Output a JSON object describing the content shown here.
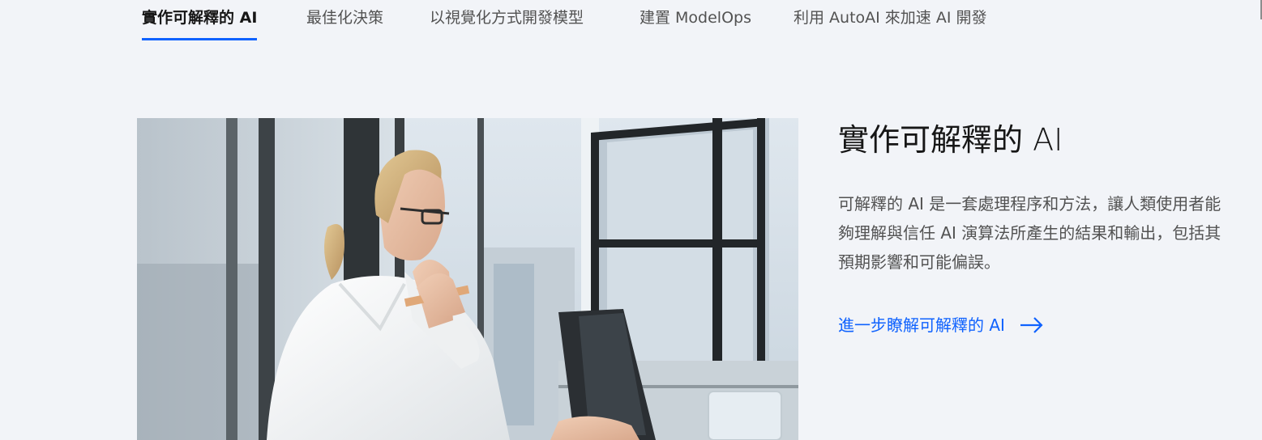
{
  "tabs": [
    {
      "label": "實作可解釋的 AI",
      "active": true
    },
    {
      "label": "最佳化決策",
      "active": false
    },
    {
      "label": "以視覺化方式開發模型",
      "active": false
    },
    {
      "label": "建置 ModelOps",
      "active": false
    },
    {
      "label": "利用 AutoAI 來加速 AI 開發",
      "active": false
    }
  ],
  "content": {
    "title": "實作可解釋的 AI",
    "description": "可解釋的 AI 是一套處理程序和方法，讓人類使用者能夠理解與信任 AI 演算法所產生的結果和輸出，包括其預期影響和可能偏誤。",
    "link_label": "進一步瞭解可解釋的 AI",
    "link_icon": "arrow-right-icon"
  },
  "colors": {
    "background": "#f2f4f8",
    "accent": "#0f62fe",
    "text_primary": "#161616",
    "text_secondary": "#525252"
  }
}
